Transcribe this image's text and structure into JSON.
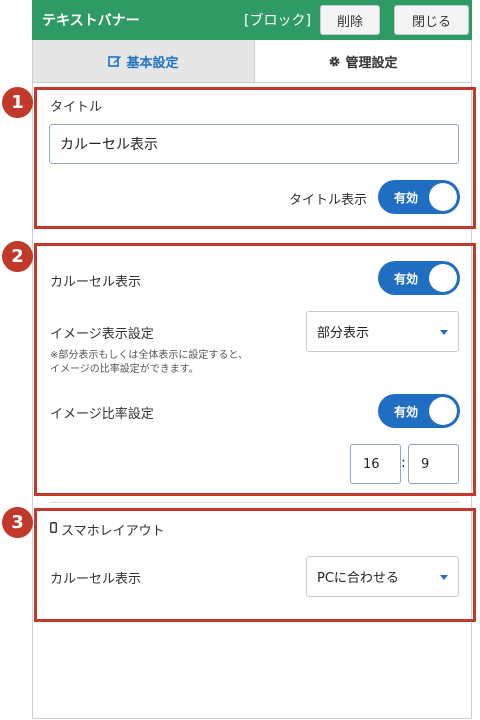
{
  "header": {
    "title": "テキストバナー",
    "tag": "[ブロック]",
    "delete_label": "削除",
    "close_label": "閉じる",
    "bg_color": "#2e9a64"
  },
  "tabs": [
    {
      "label": "基本設定",
      "icon": "edit-icon",
      "active": true
    },
    {
      "label": "管理設定",
      "icon": "gear-icon",
      "active": false
    }
  ],
  "section1": {
    "number": "1",
    "title_label": "タイトル",
    "title_value": "カルーセル表示",
    "toggle_label": "タイトル表示",
    "toggle_state": "有効"
  },
  "section2": {
    "number": "2",
    "carousel_label": "カルーセル表示",
    "carousel_toggle": "有効",
    "image_display_label": "イメージ表示設定",
    "image_display_value": "部分表示",
    "note_line1": "※部分表示もしくは全体表示に設定すると、",
    "note_line2": "イメージの比率設定ができます。",
    "ratio_label": "イメージ比率設定",
    "ratio_toggle": "有効",
    "ratio_width": "16",
    "ratio_separator": ":",
    "ratio_height": "9"
  },
  "section3": {
    "number": "3",
    "heading": "スマホレイアウト",
    "heading_icon": "phone-icon",
    "carousel_label": "カルーセル表示",
    "carousel_value": "PCに合わせる"
  },
  "colors": {
    "accent": "#1f6ec2",
    "annotation": "#c0392b"
  }
}
